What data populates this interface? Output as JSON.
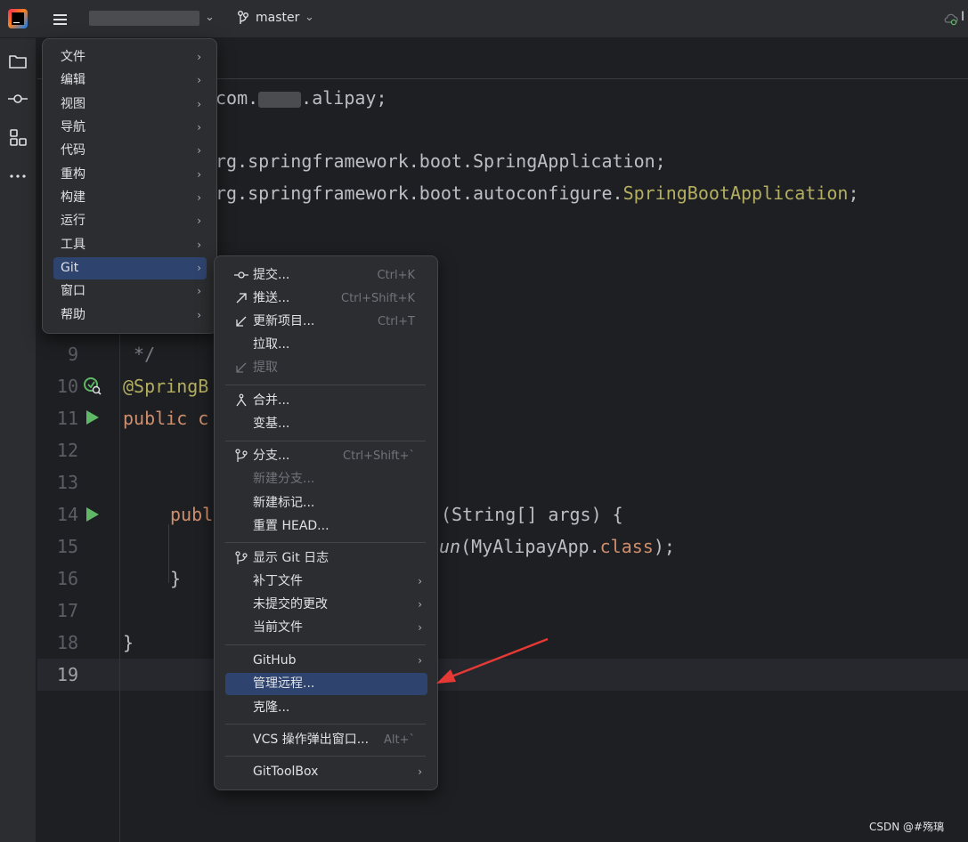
{
  "titlebar": {
    "branch": "master",
    "top_right_char": "I"
  },
  "editor": {
    "lines": [
      {
        "num": "9"
      },
      {
        "num": "10"
      },
      {
        "num": "11"
      },
      {
        "num": "12"
      },
      {
        "num": "13"
      },
      {
        "num": "14"
      },
      {
        "num": "15"
      },
      {
        "num": "16"
      },
      {
        "num": "17"
      },
      {
        "num": "18"
      },
      {
        "num": "19"
      }
    ],
    "code": {
      "pkg_a": "com.",
      "pkg_b": ".alipay;",
      "imp1": "rg.springframework.boot.SpringApplication;",
      "imp2a": "rg.springframework.boot.autoconfigure.",
      "imp2b": "SpringBootApplication",
      "imp2c": ";",
      "l9": " */",
      "l10": "@SpringB",
      "l11a": "public",
      "l11b": " c",
      "l14a": "publ",
      "l14b": "(String[] args) {",
      "l15a": "un",
      "l15b": "(MyAlipayApp.",
      "l15c": "class",
      "l15d": ");",
      "l16": "}",
      "l18": "}"
    }
  },
  "main_menu": {
    "items": [
      {
        "label": "文件"
      },
      {
        "label": "编辑"
      },
      {
        "label": "视图"
      },
      {
        "label": "导航"
      },
      {
        "label": "代码"
      },
      {
        "label": "重构"
      },
      {
        "label": "构建"
      },
      {
        "label": "运行"
      },
      {
        "label": "工具"
      },
      {
        "label": "Git"
      },
      {
        "label": "窗口"
      },
      {
        "label": "帮助"
      }
    ],
    "chevron": "›"
  },
  "git_menu": {
    "items": [
      {
        "label": "提交...",
        "shortcut": "Ctrl+K",
        "icon": "commit-icon"
      },
      {
        "label": "推送...",
        "shortcut": "Ctrl+Shift+K",
        "icon": "push-arrow-icon"
      },
      {
        "label": "更新项目...",
        "shortcut": "Ctrl+T",
        "icon": "update-arrow-icon"
      },
      {
        "label": "拉取..."
      },
      {
        "label": "提取",
        "disabled": true,
        "icon": "fetch-arrow-icon"
      },
      {
        "label": "合并...",
        "icon": "merge-icon"
      },
      {
        "label": "变基..."
      },
      {
        "label": "分支...",
        "shortcut": "Ctrl+Shift+`",
        "icon": "branch-icon"
      },
      {
        "label": "新建分支...",
        "disabled": true
      },
      {
        "label": "新建标记..."
      },
      {
        "label": "重置 HEAD..."
      },
      {
        "label": "显示 Git 日志",
        "icon": "git-log-icon"
      },
      {
        "label": "补丁文件",
        "submenu": true
      },
      {
        "label": "未提交的更改",
        "submenu": true
      },
      {
        "label": "当前文件",
        "submenu": true
      },
      {
        "label": "GitHub",
        "submenu": true
      },
      {
        "label": "管理远程...",
        "selected": true
      },
      {
        "label": "克隆..."
      },
      {
        "label": "VCS 操作弹出窗口...",
        "shortcut": "Alt+`"
      },
      {
        "label": "GitToolBox",
        "submenu": true
      }
    ]
  },
  "watermark": "CSDN @#殇璃",
  "colors": {
    "selection": "#2e436e",
    "keyword": "#cf8e6d",
    "annotation": "#b3ae60",
    "arrow": "#e53935"
  }
}
